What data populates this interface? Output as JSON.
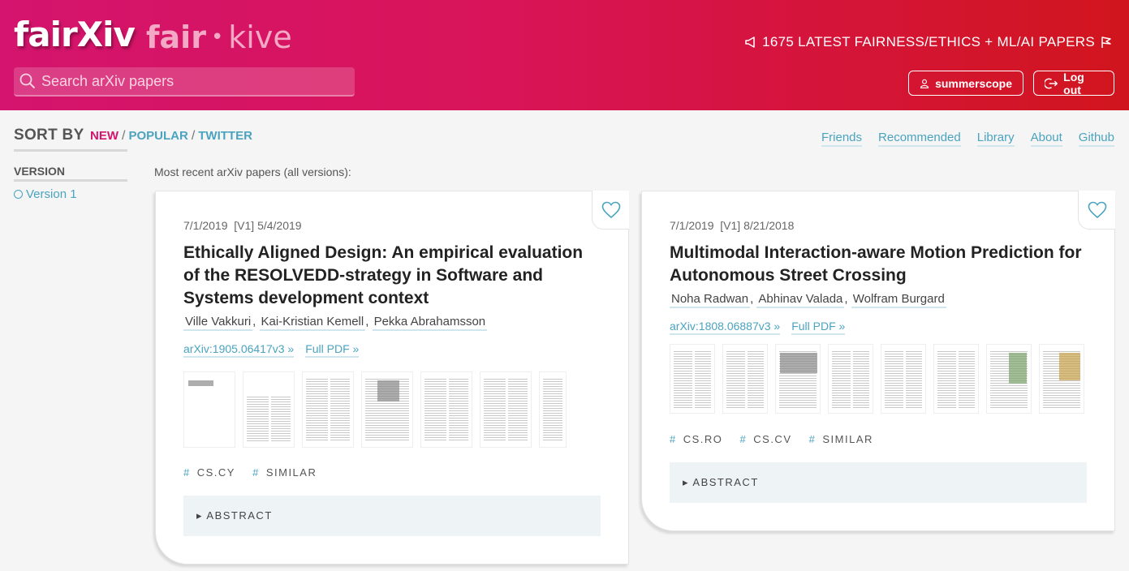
{
  "header": {
    "logo": "fairXiv",
    "sublogo_left": "fair",
    "sublogo_dot": "•",
    "sublogo_right": "kive",
    "search_placeholder": "Search arXiv papers",
    "tagline": "1675 LATEST FAIRNESS/ETHICS + ML/AI PAPERS",
    "user_label": "summerscope",
    "logout_label": "Log out"
  },
  "sort": {
    "label": "SORT BY",
    "options": [
      "NEW",
      "POPULAR",
      "TWITTER"
    ],
    "separator": "/"
  },
  "nav": [
    "Friends",
    "Recommended",
    "Library",
    "About",
    "Github"
  ],
  "sidebar": {
    "version_header": "VERSION",
    "version_item": "Version 1"
  },
  "main": {
    "heading": "Most recent arXiv papers (all versions):"
  },
  "papers": [
    {
      "date": "7/1/2019",
      "version": "[V1] 5/4/2019",
      "title": "Ethically Aligned Design: An empirical evaluation of the RESOLVEDD-strategy in Software and Systems development context",
      "authors": [
        "Ville Vakkuri",
        "Kai-Kristian Kemell",
        "Pekka Abrahamsson"
      ],
      "arxiv": "arXiv:1905.06417v3 »",
      "pdf": "Full PDF »",
      "tags": [
        "CS.CY",
        "SIMILAR"
      ],
      "abstract_label": "▸ ABSTRACT"
    },
    {
      "date": "7/1/2019",
      "version": "[V1] 8/21/2018",
      "title": "Multimodal Interaction-aware Motion Prediction for Autonomous Street Crossing",
      "authors": [
        "Noha Radwan",
        "Abhinav Valada",
        "Wolfram Burgard"
      ],
      "arxiv": "arXiv:1808.06887v3 »",
      "pdf": "Full PDF »",
      "tags": [
        "CS.RO",
        "CS.CV",
        "SIMILAR"
      ],
      "abstract_label": "▸ ABSTRACT"
    }
  ],
  "colors": {
    "header_start": "#d4146e",
    "header_end": "#d1151d",
    "accent_link": "#4aa3bf",
    "sort_active": "#d4146e"
  }
}
